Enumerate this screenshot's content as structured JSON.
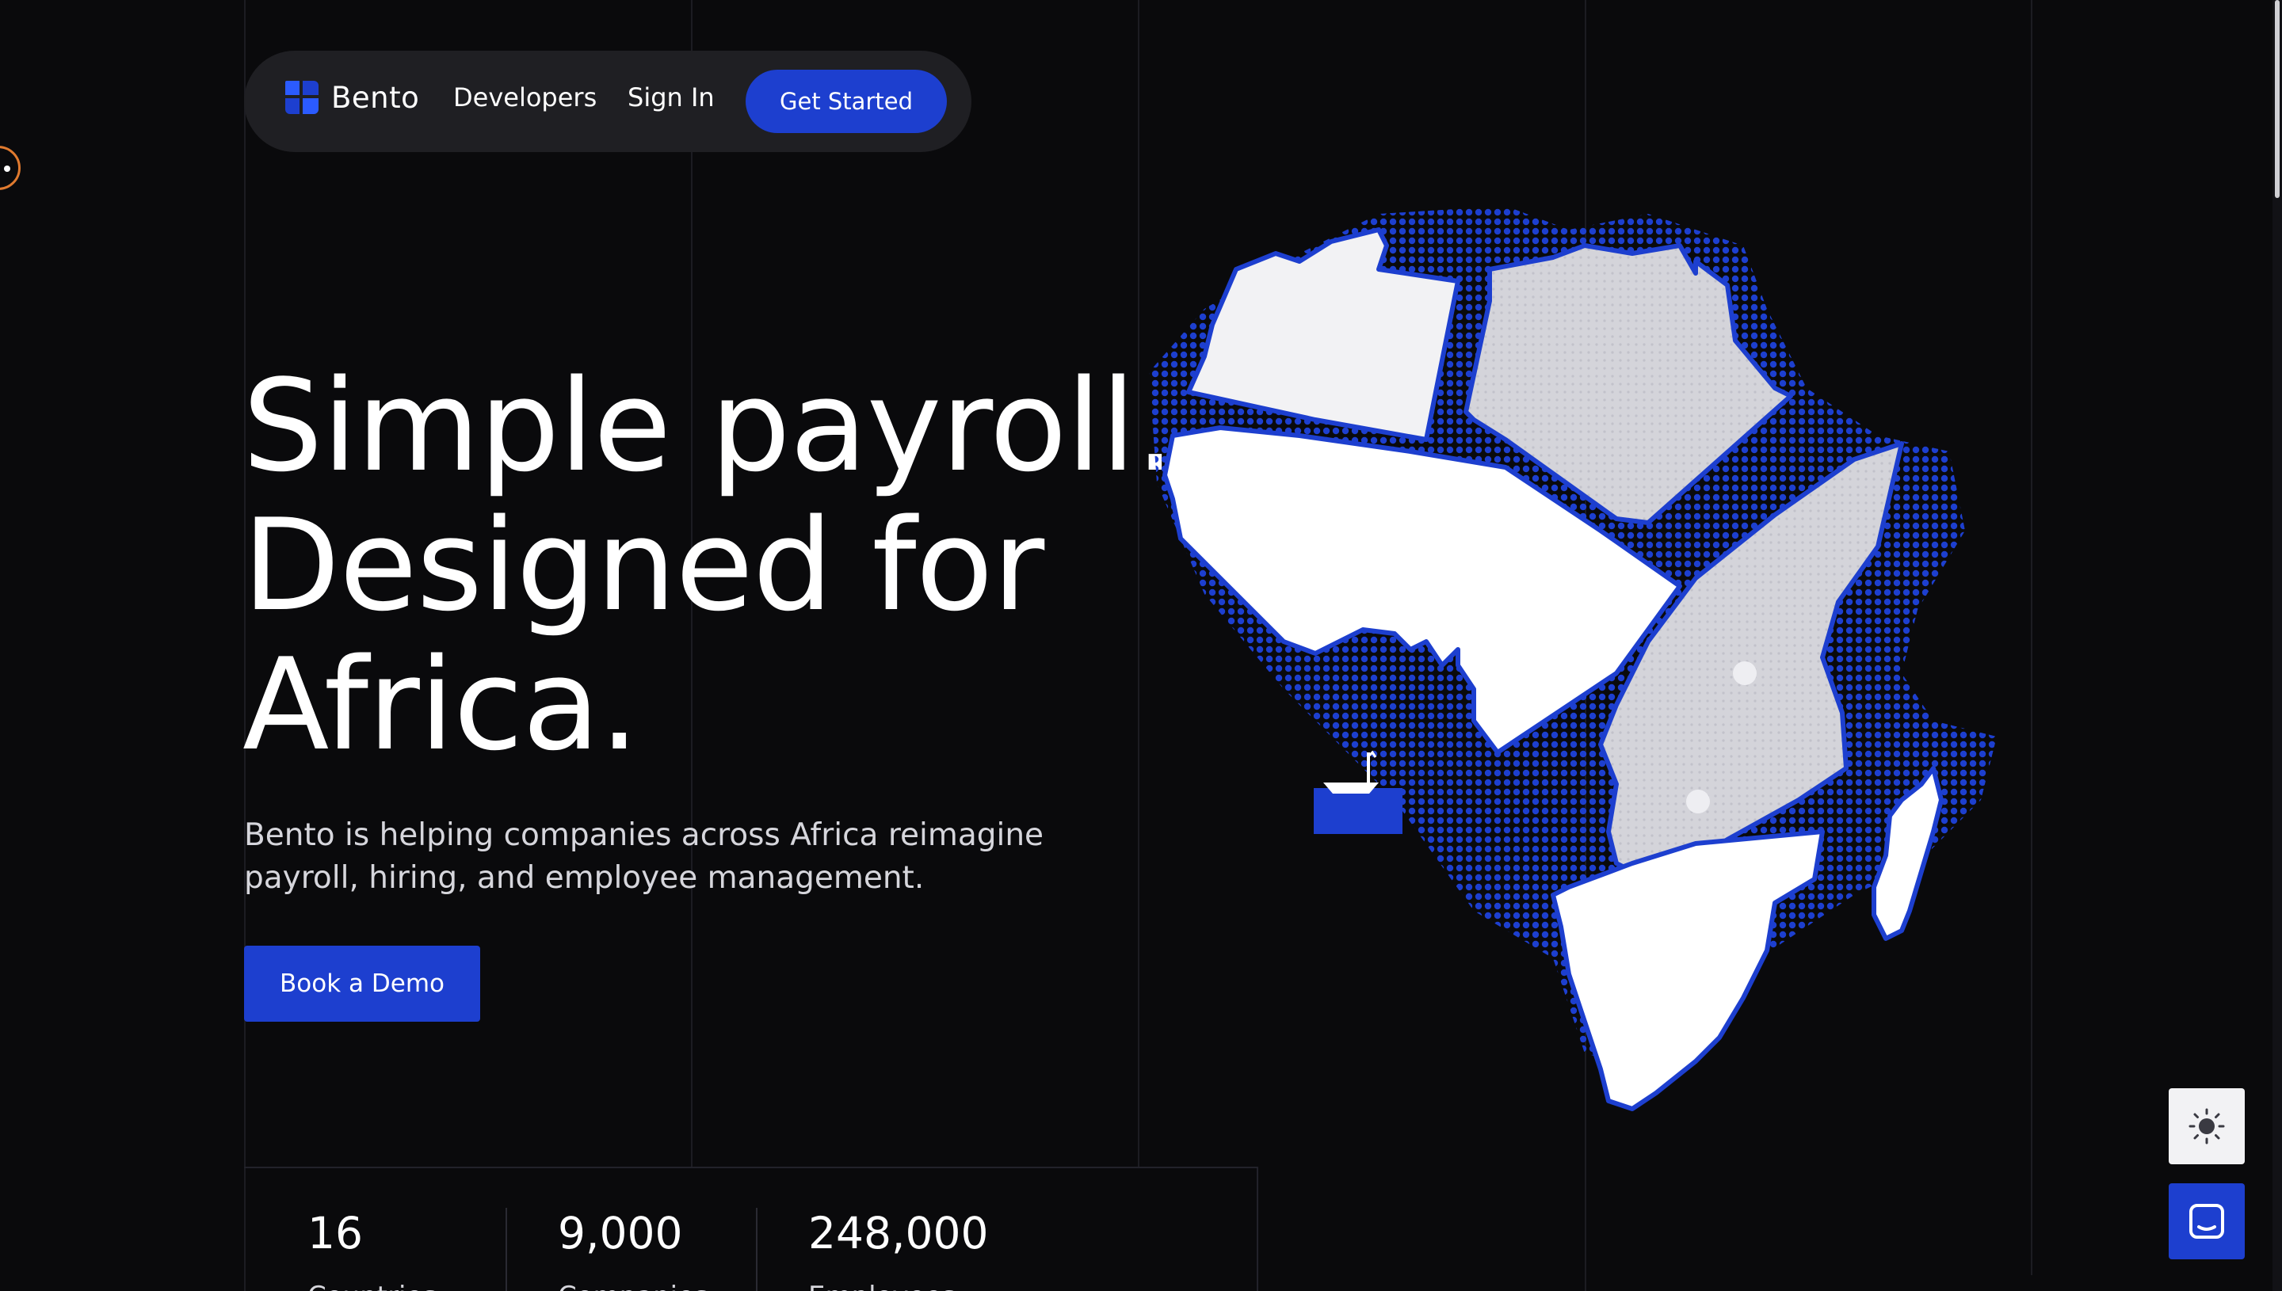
{
  "nav": {
    "brand_name": "Bento",
    "links": [
      {
        "label": "Developers"
      },
      {
        "label": "Sign In"
      }
    ],
    "cta_label": "Get Started"
  },
  "hero": {
    "headline_lines": [
      "Simple payroll.",
      "Designed for",
      "Africa."
    ],
    "subtext": "Bento is helping companies across Africa reimagine payroll, hiring, and employee management.",
    "cta_label": "Book a Demo"
  },
  "stats": [
    {
      "value": "16",
      "label": "Countries"
    },
    {
      "value": "9,000",
      "label": "Companies"
    },
    {
      "value": "248,000",
      "label": "Employees"
    }
  ],
  "colors": {
    "background": "#0a0a0c",
    "accent": "#1d3fcf",
    "nav_bg": "#1f1f23",
    "region_light": "#ffffff",
    "region_grey": "#d4d4da"
  },
  "icons": {
    "brand": "bento-logo-icon",
    "theme": "sun-icon",
    "chat": "chat-icon"
  }
}
